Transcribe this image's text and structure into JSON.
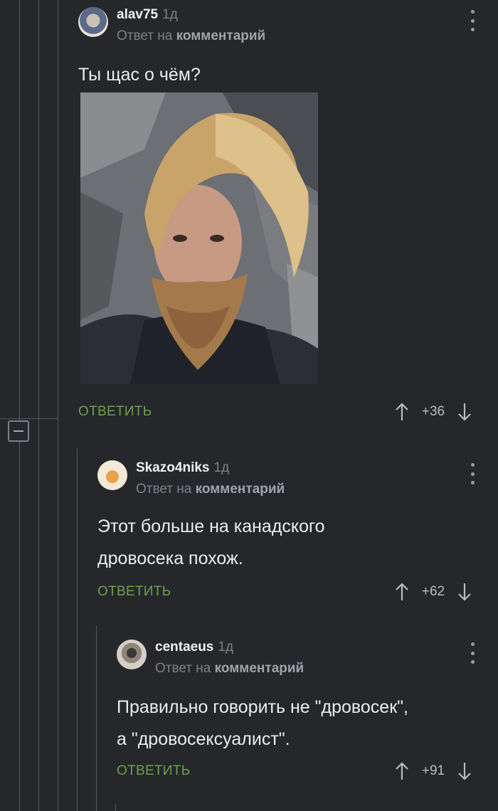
{
  "comments": [
    {
      "username": "alav75",
      "time": "1д",
      "reply_prefix": "Ответ на",
      "reply_link": "комментарий",
      "text": "Ты щас о чём?",
      "reply_label": "ОТВЕТИТЬ",
      "score": "+36"
    },
    {
      "username": "Skazo4niks",
      "time": "1д",
      "reply_prefix": "Ответ на",
      "reply_link": "комментарий",
      "text_lines": [
        "Этот больше на канадского",
        "дровосека похож."
      ],
      "reply_label": "ОТВЕТИТЬ",
      "score": "+62"
    },
    {
      "username": "centaeus",
      "time": "1д",
      "reply_prefix": "Ответ на",
      "reply_link": "комментарий",
      "text_lines": [
        "Правильно говорить не \"дровосек\",",
        "а \"дровосексуалист\"."
      ],
      "reply_label": "ОТВЕТИТЬ",
      "score": "+91"
    }
  ],
  "icons": {
    "upvote": "arrow-up-icon",
    "downvote": "arrow-down-icon",
    "more": "more-vertical-icon",
    "collapse": "collapse-minus-icon"
  },
  "colors": {
    "background": "#25272b",
    "accent_green": "#6ea04d",
    "muted": "#7e8187"
  }
}
